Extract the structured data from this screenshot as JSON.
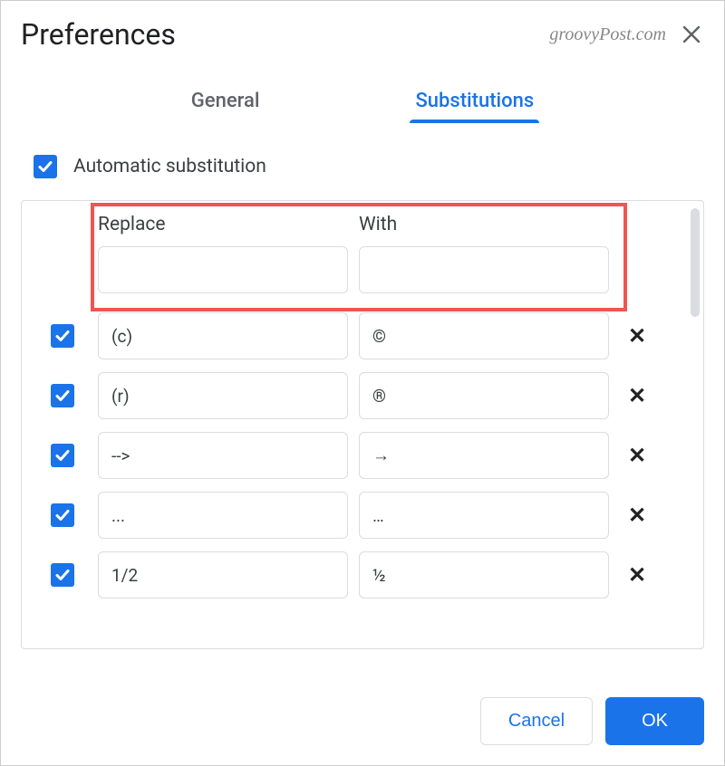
{
  "dialog": {
    "title": "Preferences",
    "watermark": "groovyPost.com"
  },
  "tabs": {
    "general": "General",
    "substitutions": "Substitutions"
  },
  "autoSub": {
    "label": "Automatic substitution",
    "checked": true
  },
  "columns": {
    "replace": "Replace",
    "with": "With"
  },
  "newRow": {
    "replace": "",
    "with": ""
  },
  "rows": [
    {
      "checked": true,
      "replace": "(c)",
      "with": "©"
    },
    {
      "checked": true,
      "replace": "(r)",
      "with": "®"
    },
    {
      "checked": true,
      "replace": "-->",
      "with": "→"
    },
    {
      "checked": true,
      "replace": "...",
      "with": "…"
    },
    {
      "checked": true,
      "replace": "1/2",
      "with": "½"
    }
  ],
  "buttons": {
    "cancel": "Cancel",
    "ok": "OK"
  }
}
